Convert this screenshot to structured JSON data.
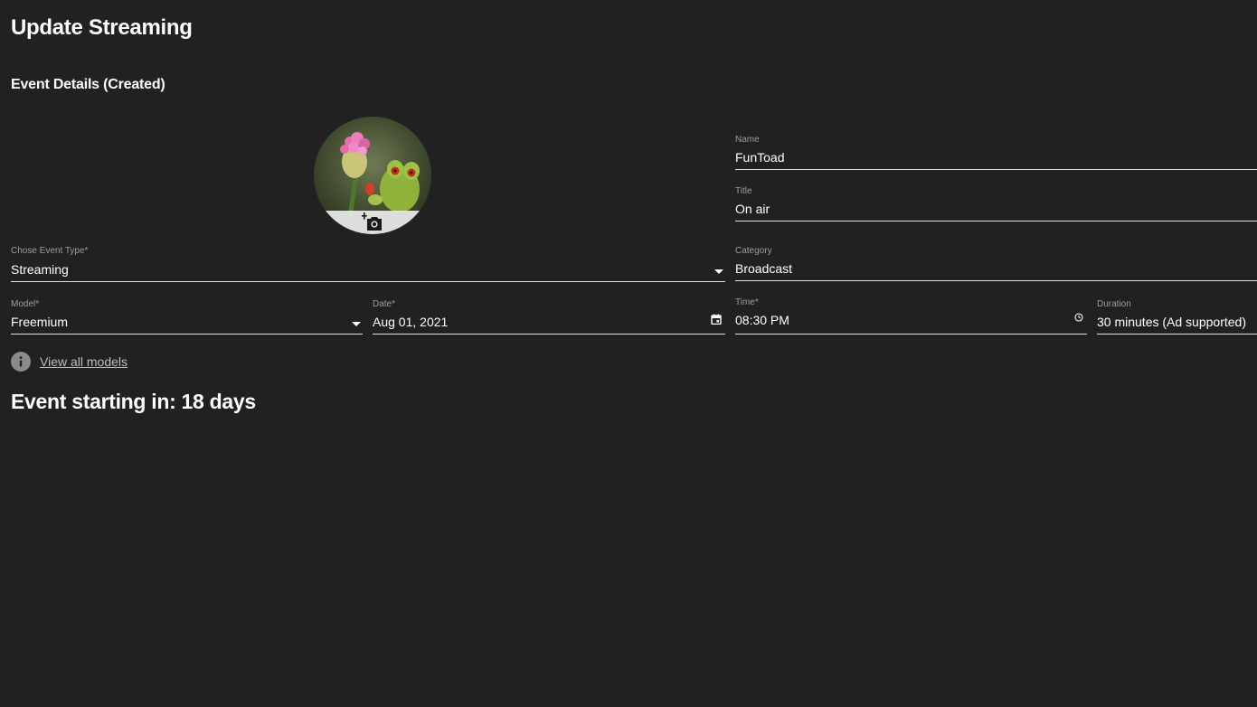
{
  "page": {
    "title": "Update Streaming",
    "section_title": "Event Details (Created)"
  },
  "avatar": {
    "icon": "add-photo-camera-icon"
  },
  "fields": {
    "name": {
      "label": "Name",
      "value": "FunToad"
    },
    "title": {
      "label": "Title",
      "value": "On air"
    },
    "event_type": {
      "label": "Chose Event Type*",
      "value": "Streaming"
    },
    "category": {
      "label": "Category",
      "value": "Broadcast"
    },
    "model": {
      "label": "Model*",
      "value": "Freemium"
    },
    "date": {
      "label": "Date*",
      "value": "Aug 01, 2021"
    },
    "time": {
      "label": "Time*",
      "value": "08:30  PM"
    },
    "duration": {
      "label": "Duration",
      "value": "30 minutes (Ad supported)"
    }
  },
  "info": {
    "link_label": "View all models"
  },
  "countdown": {
    "text": "Event starting in: 18 days"
  }
}
